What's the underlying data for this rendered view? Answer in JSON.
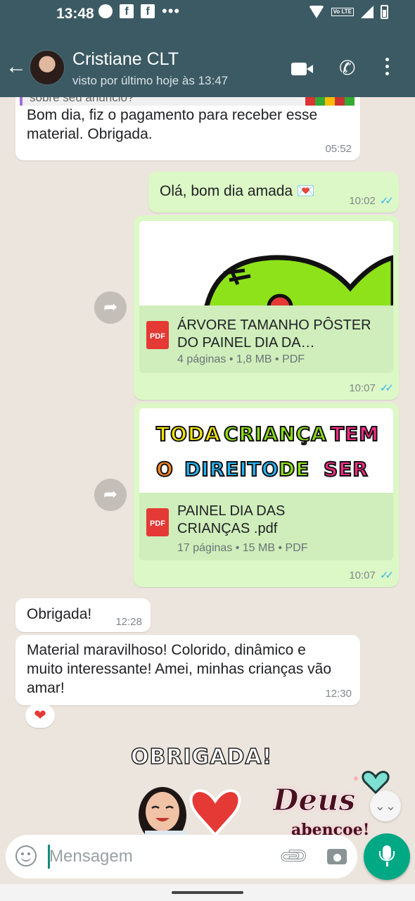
{
  "status_bar": {
    "time": "13:48",
    "volte": "Vo LTE"
  },
  "header": {
    "contact_name": "Cristiane CLT",
    "last_seen": "visto por último hoje às 13:47"
  },
  "messages": [
    {
      "id": "m1",
      "direction": "in",
      "quoted_text": "sobre seu anúncio?",
      "text": "Bom dia, fiz o pagamento para receber esse material.  Obrigada.",
      "time": "05:52"
    },
    {
      "id": "m2",
      "direction": "out",
      "text": "Olá, bom dia amada 💌",
      "time": "10:02",
      "read": true
    },
    {
      "id": "m3",
      "direction": "out",
      "type": "document",
      "doc_title": "ÁRVORE TAMANHO PÔSTER DO PAINEL DIA DA…",
      "doc_meta": "4 páginas • 1,8 MB • PDF",
      "file_icon": "PDF",
      "time": "10:07",
      "read": true
    },
    {
      "id": "m4",
      "direction": "out",
      "type": "document",
      "preview_line1": [
        "TODA",
        "CRIANÇA",
        "TEM"
      ],
      "preview_line2": [
        "O",
        "DIREITO",
        "DE",
        "SER"
      ],
      "doc_title": "PAINEL DIA DAS CRIANÇAS .pdf",
      "doc_meta": "17 páginas • 15 MB • PDF",
      "file_icon": "PDF",
      "time": "10:07",
      "read": true
    },
    {
      "id": "m5",
      "direction": "in",
      "text": "Obrigada!",
      "time": "12:28"
    },
    {
      "id": "m6",
      "direction": "in",
      "text": "Material maravilhoso! Colorido, dinâmico e muito interessante! Amei, minhas crianças vão amar!",
      "time": "12:30",
      "reaction": "❤"
    }
  ],
  "stickers": {
    "sticker1_text": "OBRIGADA!",
    "sticker2_text": "Deus",
    "sticker2_sub": "abençoe!"
  },
  "composer": {
    "placeholder": "Mensagem"
  },
  "icons": [
    "back-arrow-icon",
    "video-call-icon",
    "phone-icon",
    "more-menu-icon",
    "forward-icon",
    "pdf-icon",
    "read-receipt-icon",
    "emoji-icon",
    "attach-icon",
    "camera-icon",
    "mic-icon",
    "scroll-down-icon"
  ],
  "colors": {
    "header": "#3c5a64",
    "outgoing": "#dcf8c6",
    "incoming": "#ffffff",
    "accent": "#00a884",
    "read_ticks": "#34b7f1"
  }
}
